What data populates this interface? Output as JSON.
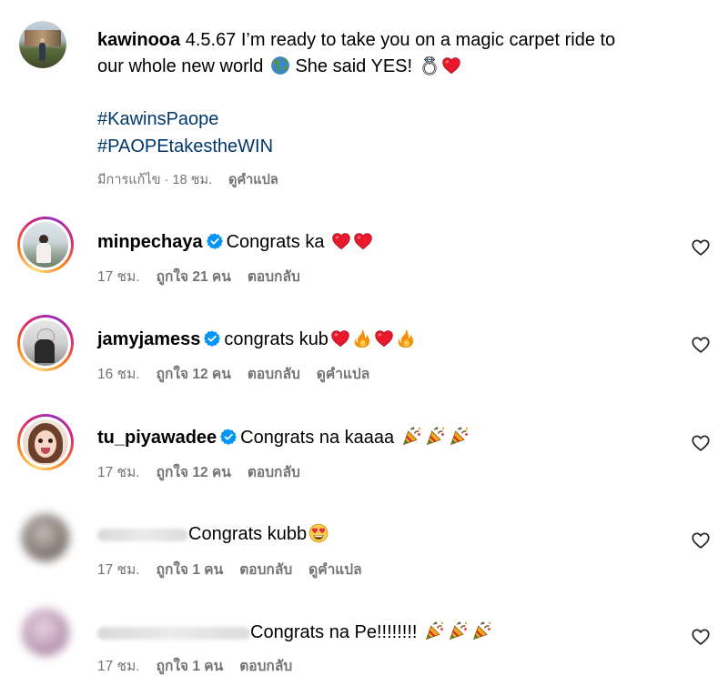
{
  "post": {
    "username": "kawinooa",
    "caption": "4.5.67 I’m ready to take you on a magic carpet ride to",
    "caption_line2": "our whole new world",
    "caption_line2b": "She said YES!",
    "hashtags": [
      "#KawinsPaope",
      "#PAOPEtakestheWIN"
    ],
    "edited": "มีการแก้ไข",
    "time": "18 ชม.",
    "see_translation": "ดูคำแปล"
  },
  "comments": [
    {
      "username": "minpechaya",
      "verified": true,
      "text": "Congrats ka",
      "time": "17 ชม.",
      "likes": "ถูกใจ 21 คน",
      "reply": "ตอบกลับ",
      "translate": ""
    },
    {
      "username": "jamyjamess",
      "verified": true,
      "text": "congrats kub",
      "time": "16 ชม.",
      "likes": "ถูกใจ 12 คน",
      "reply": "ตอบกลับ",
      "translate": "ดูคำแปล"
    },
    {
      "username": "tu_piyawadee",
      "verified": true,
      "text": "Congrats na kaaaa",
      "time": "17 ชม.",
      "likes": "ถูกใจ 12 คน",
      "reply": "ตอบกลับ",
      "translate": ""
    },
    {
      "username": "",
      "verified": false,
      "text": "Congrats kubb",
      "time": "17 ชม.",
      "likes": "ถูกใจ 1 คน",
      "reply": "ตอบกลับ",
      "translate": "ดูคำแปล"
    },
    {
      "username": "",
      "verified": false,
      "text": "Congrats na Pe!!!!!!!!",
      "time": "17 ชม.",
      "likes": "ถูกใจ 1 คน",
      "reply": "ตอบกลับ",
      "translate": ""
    }
  ],
  "separator": "·",
  "colors": {
    "link": "#00376b",
    "meta": "#737373",
    "verified": "#0095f6",
    "heart": "#e0245e"
  },
  "icons": [
    "heart-outline-icon",
    "verified-badge-icon",
    "globe-emoji",
    "ring-emoji",
    "red-heart-emoji",
    "fire-emoji",
    "party-popper-emoji",
    "heart-eyes-emoji"
  ]
}
